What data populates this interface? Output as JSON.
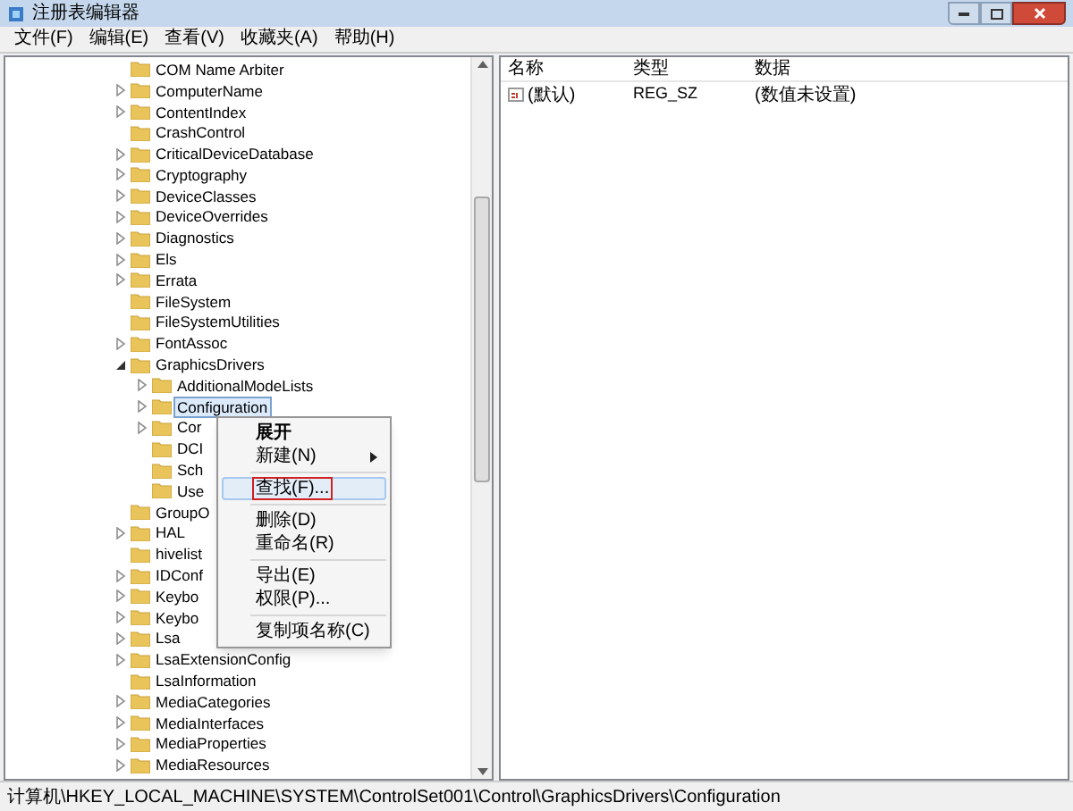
{
  "window": {
    "title": "注册表编辑器"
  },
  "menu": [
    "文件(F)",
    "编辑(E)",
    "查看(V)",
    "收藏夹(A)",
    "帮助(H)"
  ],
  "tree": [
    {
      "label": "COM Name Arbiter",
      "selected": false
    },
    {
      "label": "ComputerName",
      "expanded": false,
      "selected": false
    },
    {
      "label": "ContentIndex",
      "expanded": false,
      "selected": false
    },
    {
      "label": "CrashControl",
      "selected": false
    },
    {
      "label": "CriticalDeviceDatabase",
      "expanded": false,
      "selected": false
    },
    {
      "label": "Cryptography",
      "expanded": false,
      "selected": false
    },
    {
      "label": "DeviceClasses",
      "expanded": false,
      "selected": false
    },
    {
      "label": "DeviceOverrides",
      "expanded": false,
      "selected": false
    },
    {
      "label": "Diagnostics",
      "expanded": false,
      "selected": false
    },
    {
      "label": "Els",
      "expanded": false,
      "selected": false
    },
    {
      "label": "Errata",
      "expanded": false,
      "selected": false
    },
    {
      "label": "FileSystem",
      "selected": false
    },
    {
      "label": "FileSystemUtilities",
      "selected": false
    },
    {
      "label": "FontAssoc",
      "expanded": false,
      "selected": false
    },
    {
      "label": "GraphicsDrivers",
      "expanded": true,
      "selected": false,
      "children": [
        {
          "label": "AdditionalModeLists",
          "expanded": false,
          "selected": false
        },
        {
          "label": "Configuration",
          "expanded": false,
          "selected": true
        },
        {
          "label": "Cor",
          "expanded": false,
          "selected": false
        },
        {
          "label": "DCI",
          "selected": false
        },
        {
          "label": "Sch",
          "selected": false
        },
        {
          "label": "Use",
          "selected": false
        }
      ]
    },
    {
      "label": "GroupO",
      "selected": false
    },
    {
      "label": "HAL",
      "expanded": false,
      "selected": false
    },
    {
      "label": "hivelist",
      "selected": false
    },
    {
      "label": "IDConf",
      "expanded": false,
      "selected": false
    },
    {
      "label": "Keybo",
      "expanded": false,
      "selected": false
    },
    {
      "label": "Keybo",
      "expanded": false,
      "selected": false
    },
    {
      "label": "Lsa",
      "expanded": false,
      "selected": false
    },
    {
      "label": "LsaExtensionConfig",
      "expanded": false,
      "selected": false
    },
    {
      "label": "LsaInformation",
      "selected": false
    },
    {
      "label": "MediaCategories",
      "expanded": false,
      "selected": false
    },
    {
      "label": "MediaInterfaces",
      "expanded": false,
      "selected": false
    },
    {
      "label": "MediaProperties",
      "expanded": false,
      "selected": false
    },
    {
      "label": "MediaResources",
      "expanded": false,
      "selected": false
    }
  ],
  "context_menu": [
    {
      "kind": "item",
      "label": "展开",
      "bold": true,
      "submenu": false,
      "selected": false,
      "boxed": false
    },
    {
      "kind": "item",
      "label": "新建(N)",
      "bold": false,
      "submenu": true,
      "selected": false,
      "boxed": false
    },
    {
      "kind": "separator"
    },
    {
      "kind": "item",
      "label": "查找(F)...",
      "bold": false,
      "submenu": false,
      "selected": true,
      "boxed": true
    },
    {
      "kind": "separator"
    },
    {
      "kind": "item",
      "label": "删除(D)",
      "bold": false,
      "submenu": false,
      "selected": false,
      "boxed": false
    },
    {
      "kind": "item",
      "label": "重命名(R)",
      "bold": false,
      "submenu": false,
      "selected": false,
      "boxed": false
    },
    {
      "kind": "separator"
    },
    {
      "kind": "item",
      "label": "导出(E)",
      "bold": false,
      "submenu": false,
      "selected": false,
      "boxed": false
    },
    {
      "kind": "item",
      "label": "权限(P)...",
      "bold": false,
      "submenu": false,
      "selected": false,
      "boxed": false
    },
    {
      "kind": "separator"
    },
    {
      "kind": "item",
      "label": "复制项名称(C)",
      "bold": false,
      "submenu": false,
      "selected": false,
      "boxed": false
    }
  ],
  "values": {
    "columns": [
      "名称",
      "类型",
      "数据"
    ],
    "rows": [
      {
        "name": "(默认)",
        "type": "REG_SZ",
        "data": "(数值未设置)"
      }
    ]
  },
  "status_bar": "计算机\\HKEY_LOCAL_MACHINE\\SYSTEM\\ControlSet001\\Control\\GraphicsDrivers\\Configuration"
}
